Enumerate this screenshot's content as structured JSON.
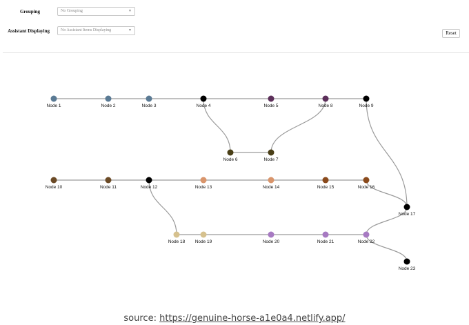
{
  "controls": {
    "grouping_label": "Grouping",
    "grouping_value": "No Grouping",
    "assistant_label": "Assistant Displaying",
    "assistant_value": "No Assistant Items Displaying",
    "reset_label": "Reset"
  },
  "graph": {
    "nodes": [
      {
        "id": "n1",
        "label": "Node 1",
        "color": "#5a7a94"
      },
      {
        "id": "n2",
        "label": "Node 2",
        "color": "#5a7a94"
      },
      {
        "id": "n3",
        "label": "Node 3",
        "color": "#5a7a94"
      },
      {
        "id": "n4",
        "label": "Node 4",
        "color": "#000000"
      },
      {
        "id": "n5",
        "label": "Node 5",
        "color": "#5c2f5a"
      },
      {
        "id": "n8",
        "label": "Node 8",
        "color": "#5c2f5a"
      },
      {
        "id": "n9",
        "label": "Node 9",
        "color": "#000000"
      },
      {
        "id": "n6",
        "label": "Node 6",
        "color": "#4a3f17"
      },
      {
        "id": "n7",
        "label": "Node 7",
        "color": "#4a3f17"
      },
      {
        "id": "n10",
        "label": "Node 10",
        "color": "#6b4a26"
      },
      {
        "id": "n11",
        "label": "Node 11",
        "color": "#6b4a26"
      },
      {
        "id": "n12",
        "label": "Node 12",
        "color": "#000000"
      },
      {
        "id": "n13",
        "label": "Node 13",
        "color": "#d9956b"
      },
      {
        "id": "n14",
        "label": "Node 14",
        "color": "#d9956b"
      },
      {
        "id": "n15",
        "label": "Node 15",
        "color": "#8a4a1c"
      },
      {
        "id": "n16",
        "label": "Node 16",
        "color": "#8a4a1c"
      },
      {
        "id": "n17",
        "label": "Node 17",
        "color": "#000000"
      },
      {
        "id": "n18",
        "label": "Node 18",
        "color": "#d6c18e"
      },
      {
        "id": "n19",
        "label": "Node 19",
        "color": "#d6c18e"
      },
      {
        "id": "n20",
        "label": "Node 20",
        "color": "#a77ac2"
      },
      {
        "id": "n21",
        "label": "Node 21",
        "color": "#a77ac2"
      },
      {
        "id": "n22",
        "label": "Node 22",
        "color": "#a77ac2"
      },
      {
        "id": "n23",
        "label": "Node 23",
        "color": "#000000"
      }
    ],
    "edges": [
      [
        "n1",
        "n2"
      ],
      [
        "n2",
        "n3"
      ],
      [
        "n3",
        "n4"
      ],
      [
        "n4",
        "n5"
      ],
      [
        "n5",
        "n8"
      ],
      [
        "n8",
        "n9"
      ],
      [
        "n4",
        "n6"
      ],
      [
        "n6",
        "n7"
      ],
      [
        "n7",
        "n8"
      ],
      [
        "n10",
        "n11"
      ],
      [
        "n11",
        "n12"
      ],
      [
        "n12",
        "n13"
      ],
      [
        "n13",
        "n14"
      ],
      [
        "n14",
        "n15"
      ],
      [
        "n15",
        "n16"
      ],
      [
        "n16",
        "n17"
      ],
      [
        "n9",
        "n17"
      ],
      [
        "n12",
        "n18"
      ],
      [
        "n18",
        "n19"
      ],
      [
        "n19",
        "n20"
      ],
      [
        "n20",
        "n21"
      ],
      [
        "n21",
        "n22"
      ],
      [
        "n22",
        "n17"
      ],
      [
        "n22",
        "n23"
      ]
    ],
    "edge_color": "#9a9a9a"
  },
  "footer": {
    "prefix": "source: ",
    "link_text": "https://genuine-horse-a1e0a4.netlify.app/"
  }
}
